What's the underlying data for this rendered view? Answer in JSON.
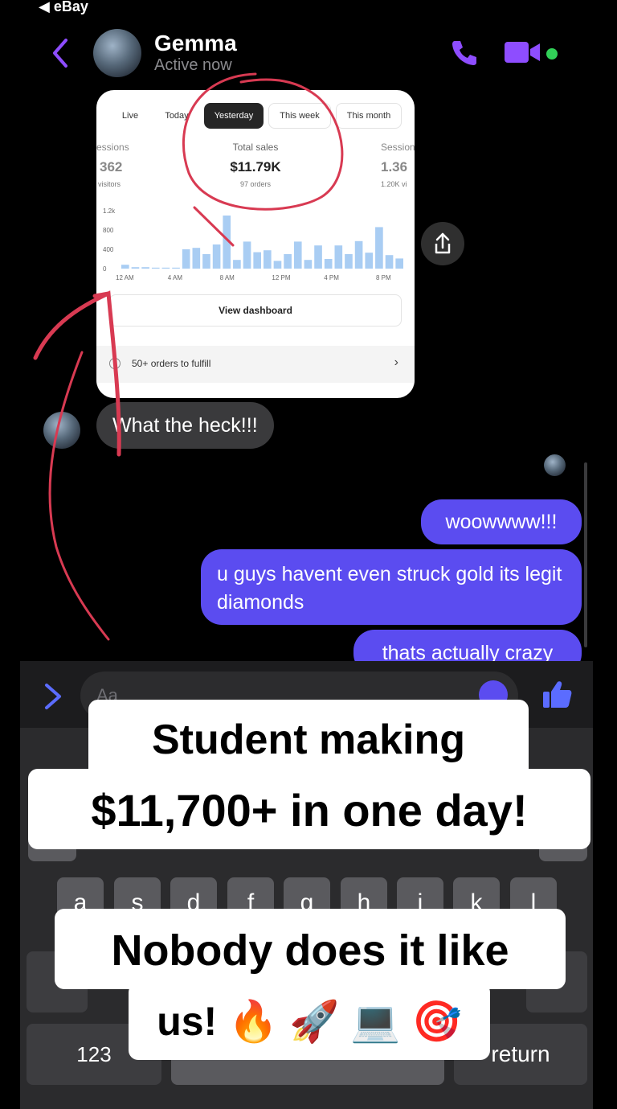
{
  "status": {
    "back_app": "◀ eBay"
  },
  "header": {
    "name": "Gemma",
    "status": "Active now"
  },
  "dashboard": {
    "tabs": [
      "Live",
      "Today",
      "Yesterday",
      "This week",
      "This month"
    ],
    "selected_tab": "Yesterday",
    "metrics": {
      "left": {
        "label": "essions",
        "value": "362",
        "sub": "visitors"
      },
      "center": {
        "label": "Total sales",
        "value": "$11.79K",
        "sub": "97 orders"
      },
      "right": {
        "label": "Session",
        "value": "1.36",
        "sub": "1.20K vi"
      }
    },
    "view_button": "View dashboard",
    "fulfill": "50+ orders to fulfill"
  },
  "chart_data": {
    "type": "bar",
    "y_ticks": [
      "1.2k",
      "800",
      "400",
      "0"
    ],
    "x_ticks": [
      "12 AM",
      "4 AM",
      "8 AM",
      "12 PM",
      "4 PM",
      "8 PM"
    ],
    "ylim": [
      0,
      1200
    ],
    "values": [
      80,
      30,
      30,
      20,
      20,
      20,
      400,
      430,
      300,
      500,
      1100,
      180,
      560,
      340,
      380,
      160,
      300,
      560,
      180,
      480,
      200,
      480,
      300,
      570,
      330,
      860,
      280,
      210
    ],
    "color": "#a9cdf3"
  },
  "messages": {
    "incoming": "What the heck!!!",
    "outgoing": [
      "woowwww!!!",
      "u guys havent even struck gold its legit diamonds",
      "thats actually crazy"
    ]
  },
  "composer": {
    "placeholder": "Aa"
  },
  "keyboard": {
    "row2": [
      "a",
      "s",
      "d",
      "f",
      "g",
      "h",
      "j",
      "k",
      "l"
    ],
    "numbers": "123",
    "return": "return"
  },
  "caption": {
    "line1": "Student making",
    "line2": "$11,700+ in one day!",
    "line3": "Nobody does it like",
    "line4": "us! 🔥 🚀 💻 🎯"
  },
  "colors": {
    "accent": "#5b4cf0",
    "purple_icon": "#8e4dff",
    "annotation": "#d83a52",
    "online": "#31d158"
  }
}
